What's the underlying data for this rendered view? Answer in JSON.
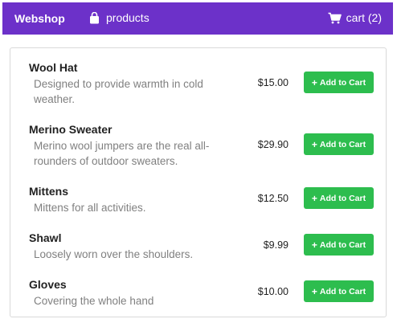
{
  "navbar": {
    "brand": "Webshop",
    "products_label": "products",
    "cart_label": "cart (2)"
  },
  "products": [
    {
      "name": "Wool Hat",
      "description_lines": [
        "Designed to provide warmth in cold",
        "weather."
      ],
      "price": "$15.00",
      "button_label": "Add to Cart"
    },
    {
      "name": "Merino Sweater",
      "description_lines": [
        "Merino wool jumpers are the real all-",
        "rounders of outdoor sweaters."
      ],
      "price": "$29.90",
      "button_label": "Add to Cart"
    },
    {
      "name": "Mittens",
      "description_lines": [
        "Mittens for all activities."
      ],
      "price": "$12.50",
      "button_label": "Add to Cart"
    },
    {
      "name": "Shawl",
      "description_lines": [
        "Loosely worn over the shoulders."
      ],
      "price": "$9.99",
      "button_label": "Add to Cart"
    },
    {
      "name": "Gloves",
      "description_lines": [
        "Covering the whole hand"
      ],
      "price": "$10.00",
      "button_label": "Add to Cart"
    }
  ],
  "colors": {
    "navbar": "#6c31c9",
    "button": "#2dbd4e",
    "description": "#808080"
  }
}
